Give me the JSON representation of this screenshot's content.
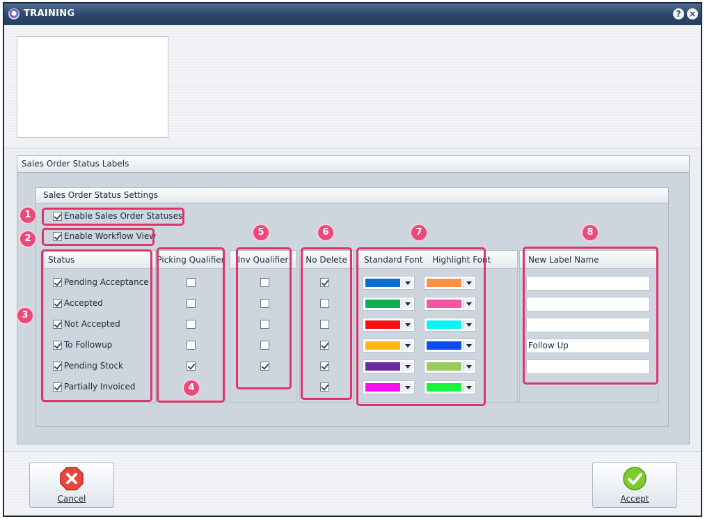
{
  "window": {
    "title": "TRAINING",
    "help_glyph": "?",
    "close_glyph": "×"
  },
  "labels_group": {
    "title": "Sales Order Status Labels"
  },
  "settings_group": {
    "title": "Sales Order Status Settings",
    "enable_statuses": {
      "label": "Enable Sales Order Statuses",
      "checked": true
    },
    "enable_workflow": {
      "label": "Enable Workflow View",
      "checked": true
    }
  },
  "columns": {
    "status": "Status",
    "picking_qualifier": "Picking Qualifier",
    "inv_qualifier": "Inv Qualifier",
    "no_delete": "No Delete",
    "standard_font": "Standard Font",
    "highlight_font": "Highlight Font",
    "new_label_name": "New Label Name"
  },
  "rows": [
    {
      "status": "Pending Acceptance",
      "enabled": true,
      "picking": false,
      "inv": false,
      "no_delete": true,
      "std_color": "#0a6fc9",
      "hl_color": "#f99044",
      "new_label": ""
    },
    {
      "status": "Accepted",
      "enabled": true,
      "picking": false,
      "inv": false,
      "no_delete": false,
      "std_color": "#0fb04f",
      "hl_color": "#f751a8",
      "new_label": ""
    },
    {
      "status": "Not Accepted",
      "enabled": true,
      "picking": false,
      "inv": false,
      "no_delete": false,
      "std_color": "#f70f14",
      "hl_color": "#0df2f2",
      "new_label": ""
    },
    {
      "status": "To Followup",
      "enabled": true,
      "picking": false,
      "inv": false,
      "no_delete": true,
      "std_color": "#fdb80f",
      "hl_color": "#0d4cf0",
      "new_label": "Follow Up"
    },
    {
      "status": "Pending Stock",
      "enabled": true,
      "picking": true,
      "inv": true,
      "no_delete": true,
      "std_color": "#6b2aa3",
      "hl_color": "#96cd5b",
      "new_label": ""
    },
    {
      "status": "Partially Invoiced",
      "enabled": true,
      "picking": null,
      "inv": null,
      "no_delete": true,
      "std_color": "#f70ef5",
      "hl_color": "#16f43b",
      "new_label": null
    }
  ],
  "annotations": [
    "1",
    "2",
    "3",
    "4",
    "5",
    "6",
    "7",
    "8"
  ],
  "buttons": {
    "cancel": "Cancel",
    "accept": "Accept"
  },
  "icons": {
    "cancel": "x-circle-icon",
    "accept": "check-circle-icon",
    "help": "help-icon",
    "close": "close-icon"
  }
}
